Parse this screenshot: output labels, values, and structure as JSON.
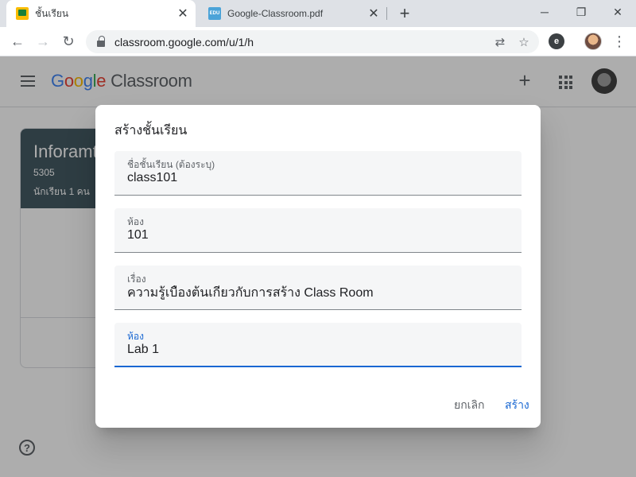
{
  "browser": {
    "tabs": [
      {
        "title": "ชั้นเรียน",
        "active": true,
        "icon": "classroom-favicon"
      },
      {
        "title": "Google-Classroom.pdf",
        "active": false,
        "icon": "edu-favicon",
        "icon_text": "EDU"
      }
    ],
    "new_tab_glyph": "+",
    "close_glyph": "✕",
    "window_controls": {
      "minimize": "─",
      "maximize": "❐",
      "close": "✕"
    },
    "nav": {
      "back": "←",
      "forward": "→",
      "reload": "↻"
    },
    "url": "classroom.google.com/u/1/h",
    "omnibox_icons": {
      "translate": "⇄",
      "star": "☆"
    },
    "extension_letter": "e",
    "menu_glyph": "⋮"
  },
  "app": {
    "brand": {
      "g": "G",
      "o1": "o",
      "o2": "o",
      "g2": "g",
      "l": "l",
      "e": "e",
      "product": "Classroom"
    },
    "create_glyph": "+",
    "class_card": {
      "title": "Inforamt",
      "code": "5305",
      "students": "นักเรียน 1 คน"
    },
    "help_glyph": "?"
  },
  "dialog": {
    "title": "สร้างชั้นเรียน",
    "fields": [
      {
        "label": "ชื่อชั้นเรียน (ต้องระบุ)",
        "value": "class101"
      },
      {
        "label": "ห้อง",
        "value": "101"
      },
      {
        "label": "เรื่อง",
        "value": "ความรู้เบื้องต้นเกี่ยวกับการสร้าง Class Room"
      },
      {
        "label": "ห้อง",
        "value": "Lab 1"
      }
    ],
    "cancel_label": "ยกเลิก",
    "create_label": "สร้าง"
  },
  "colors": {
    "accent": "#1967d2",
    "card_header": "#455a64"
  }
}
